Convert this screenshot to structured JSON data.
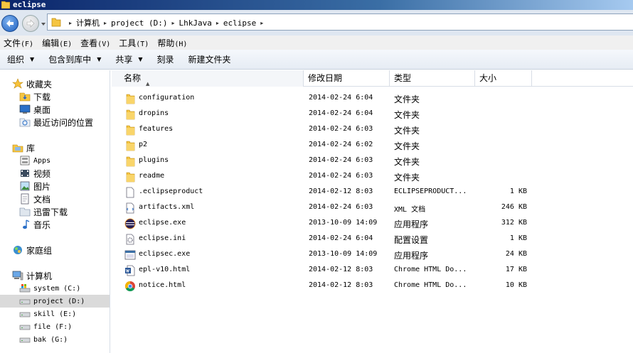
{
  "window": {
    "title": "eclipse"
  },
  "address": {
    "crumbs": [
      "计算机",
      "project (D:)",
      "LhkJava",
      "eclipse"
    ]
  },
  "menu": [
    {
      "label": "文件",
      "accel": "(F)"
    },
    {
      "label": "编辑",
      "accel": "(E)"
    },
    {
      "label": "查看",
      "accel": "(V)"
    },
    {
      "label": "工具",
      "accel": "(T)"
    },
    {
      "label": "帮助",
      "accel": "(H)"
    }
  ],
  "toolbar": {
    "organize": "组织",
    "include_library": "包含到库中",
    "share": "共享",
    "burn": "刻录",
    "new_folder": "新建文件夹"
  },
  "nav": {
    "favorites": "收藏夹",
    "downloads": "下载",
    "desktop": "桌面",
    "recent": "最近访问的位置",
    "libraries": "库",
    "apps": "Apps",
    "videos": "视频",
    "pictures": "图片",
    "documents": "文档",
    "xunlei": "迅雷下载",
    "music": "音乐",
    "homegroup": "家庭组",
    "computer": "计算机",
    "drives": [
      {
        "label": "system (C:)",
        "selected": false
      },
      {
        "label": "project (D:)",
        "selected": true
      },
      {
        "label": "skill (E:)",
        "selected": false
      },
      {
        "label": "file (F:)",
        "selected": false
      },
      {
        "label": "bak (G:)",
        "selected": false
      }
    ]
  },
  "columns": {
    "name": "名称",
    "modified": "修改日期",
    "type": "类型",
    "size": "大小"
  },
  "files": [
    {
      "name": "configuration",
      "date": "2014-02-24 6:04",
      "type": "文件夹",
      "size": "",
      "icon": "folder-icon"
    },
    {
      "name": "dropins",
      "date": "2014-02-24 6:04",
      "type": "文件夹",
      "size": "",
      "icon": "folder-icon"
    },
    {
      "name": "features",
      "date": "2014-02-24 6:03",
      "type": "文件夹",
      "size": "",
      "icon": "folder-icon"
    },
    {
      "name": "p2",
      "date": "2014-02-24 6:02",
      "type": "文件夹",
      "size": "",
      "icon": "folder-icon"
    },
    {
      "name": "plugins",
      "date": "2014-02-24 6:03",
      "type": "文件夹",
      "size": "",
      "icon": "folder-icon"
    },
    {
      "name": "readme",
      "date": "2014-02-24 6:03",
      "type": "文件夹",
      "size": "",
      "icon": "folder-icon"
    },
    {
      "name": ".eclipseproduct",
      "date": "2014-02-12 8:03",
      "type": "ECLIPSEPRODUCT...",
      "size": "1 KB",
      "icon": "file-icon"
    },
    {
      "name": "artifacts.xml",
      "date": "2014-02-24 6:03",
      "type": "XML 文档",
      "size": "246 KB",
      "icon": "xml-file-icon"
    },
    {
      "name": "eclipse.exe",
      "date": "2013-10-09 14:09",
      "type": "应用程序",
      "size": "312 KB",
      "icon": "eclipse-icon"
    },
    {
      "name": "eclipse.ini",
      "date": "2014-02-24 6:04",
      "type": "配置设置",
      "size": "1 KB",
      "icon": "ini-file-icon"
    },
    {
      "name": "eclipsec.exe",
      "date": "2013-10-09 14:09",
      "type": "应用程序",
      "size": "24 KB",
      "icon": "exe-icon"
    },
    {
      "name": "epl-v10.html",
      "date": "2014-02-12 8:03",
      "type": "Chrome HTML Do...",
      "size": "17 KB",
      "icon": "word-html-icon"
    },
    {
      "name": "notice.html",
      "date": "2014-02-12 8:03",
      "type": "Chrome HTML Do...",
      "size": "10 KB",
      "icon": "chrome-icon"
    }
  ]
}
